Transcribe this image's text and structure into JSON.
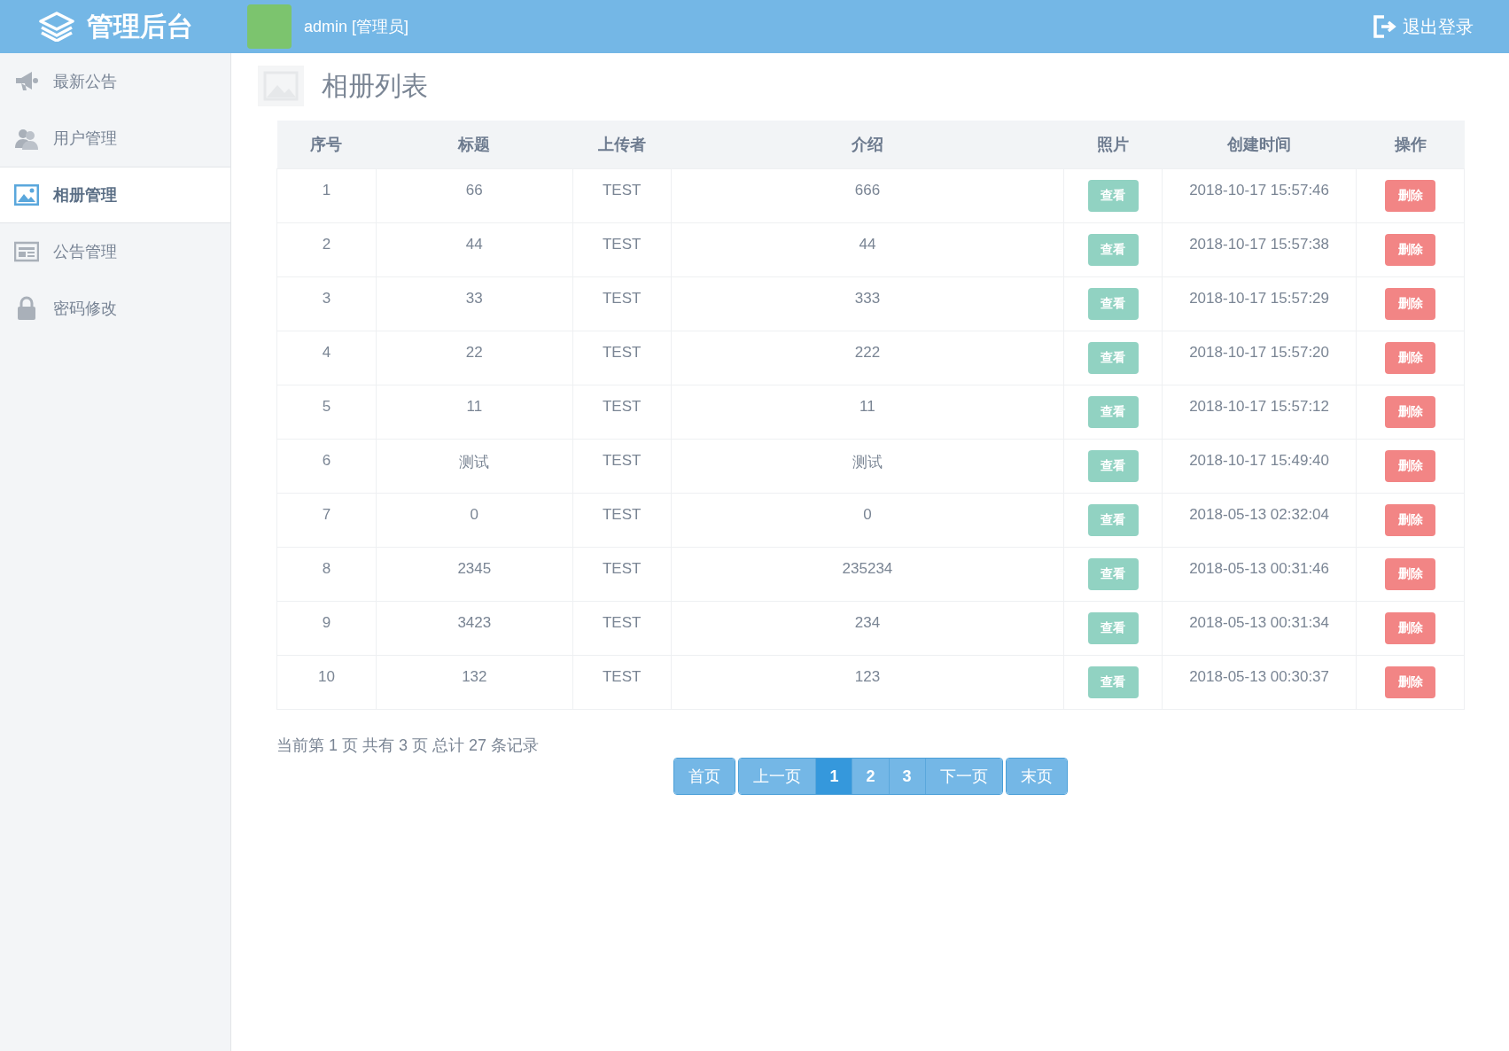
{
  "header": {
    "brand": "管理后台",
    "user": "admin [管理员]",
    "logout": "退出登录"
  },
  "sidebar": {
    "items": [
      {
        "label": "最新公告",
        "kind": "megaphone",
        "selected": false
      },
      {
        "label": "用户管理",
        "kind": "users",
        "selected": false
      },
      {
        "label": "相册管理",
        "kind": "picture",
        "selected": true
      },
      {
        "label": "公告管理",
        "kind": "news",
        "selected": false
      },
      {
        "label": "密码修改",
        "kind": "lock",
        "selected": false
      }
    ]
  },
  "page_title": "相册列表",
  "table": {
    "columns": [
      "序号",
      "标题",
      "上传者",
      "介绍",
      "照片",
      "创建时间",
      "操作"
    ],
    "rows": [
      {
        "no": "1",
        "title": "66",
        "uploader": "TEST",
        "intro": "666",
        "view": "查看",
        "created": "2018-10-17 15:57:46",
        "delete": "删除"
      },
      {
        "no": "2",
        "title": "44",
        "uploader": "TEST",
        "intro": "44",
        "view": "查看",
        "created": "2018-10-17 15:57:38",
        "delete": "删除"
      },
      {
        "no": "3",
        "title": "33",
        "uploader": "TEST",
        "intro": "333",
        "view": "查看",
        "created": "2018-10-17 15:57:29",
        "delete": "删除"
      },
      {
        "no": "4",
        "title": "22",
        "uploader": "TEST",
        "intro": "222",
        "view": "查看",
        "created": "2018-10-17 15:57:20",
        "delete": "删除"
      },
      {
        "no": "5",
        "title": "11",
        "uploader": "TEST",
        "intro": "11",
        "view": "查看",
        "created": "2018-10-17 15:57:12",
        "delete": "删除"
      },
      {
        "no": "6",
        "title": "测试",
        "uploader": "TEST",
        "intro": "测试",
        "view": "查看",
        "created": "2018-10-17 15:49:40",
        "delete": "删除"
      },
      {
        "no": "7",
        "title": "0",
        "uploader": "TEST",
        "intro": "0",
        "view": "查看",
        "created": "2018-05-13 02:32:04",
        "delete": "删除"
      },
      {
        "no": "8",
        "title": "2345",
        "uploader": "TEST",
        "intro": "235234",
        "view": "查看",
        "created": "2018-05-13 00:31:46",
        "delete": "删除"
      },
      {
        "no": "9",
        "title": "3423",
        "uploader": "TEST",
        "intro": "234",
        "view": "查看",
        "created": "2018-05-13 00:31:34",
        "delete": "删除"
      },
      {
        "no": "10",
        "title": "132",
        "uploader": "TEST",
        "intro": "123",
        "view": "查看",
        "created": "2018-05-13 00:30:37",
        "delete": "删除"
      }
    ]
  },
  "pager": {
    "summary": "当前第 1 页 共有 3 页 总计 27 条记录",
    "groups": [
      [
        {
          "label": "首页",
          "selected": false
        }
      ],
      [
        {
          "label": "上一页",
          "selected": false
        },
        {
          "label": "1",
          "selected": true
        },
        {
          "label": "2",
          "selected": false
        },
        {
          "label": "3",
          "selected": false
        },
        {
          "label": "下一页",
          "selected": false
        }
      ],
      [
        {
          "label": "末页",
          "selected": false
        }
      ]
    ]
  }
}
